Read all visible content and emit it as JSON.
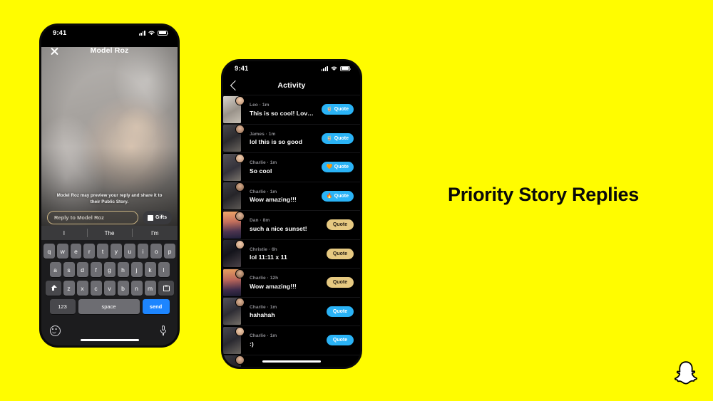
{
  "background_color": "#FFFC00",
  "headline": "Priority Story Replies",
  "brand": {
    "logo_name": "snapchat-ghost-logo"
  },
  "story_phone": {
    "status_bar": {
      "time": "9:41",
      "signal_icon": "cellular-signal-icon",
      "wifi_icon": "wifi-icon",
      "battery_icon": "battery-icon"
    },
    "close_icon": "close-icon",
    "title": "Model Roz",
    "disclaimer": "Model Roz may preview your reply and share it to their Public Story.",
    "reply_input": {
      "placeholder": "Reply to Model Roz",
      "value": ""
    },
    "gifts_button": {
      "label": "Gifts",
      "icon": "gift-icon"
    },
    "predictive": [
      "I",
      "The",
      "I'm"
    ],
    "keyboard": {
      "row1": [
        "q",
        "w",
        "e",
        "r",
        "t",
        "y",
        "u",
        "i",
        "o",
        "p"
      ],
      "row2": [
        "a",
        "s",
        "d",
        "f",
        "g",
        "h",
        "j",
        "k",
        "l"
      ],
      "row3": [
        "z",
        "x",
        "c",
        "v",
        "b",
        "n",
        "m"
      ],
      "shift_icon": "shift-icon",
      "delete_icon": "backspace-icon",
      "numeric_label": "123",
      "space_label": "space",
      "send_label": "send"
    },
    "emoji_icon": "emoji-icon",
    "mic_icon": "microphone-icon"
  },
  "activity_phone": {
    "status_bar": {
      "time": "9:41",
      "signal_icon": "cellular-signal-icon",
      "wifi_icon": "wifi-icon",
      "battery_icon": "battery-icon"
    },
    "back_icon": "back-chevron-icon",
    "title": "Activity",
    "quote_label": "Quote",
    "rows": [
      {
        "name": "Leo",
        "time": "1m",
        "message": "This is so cool! Love it!!!",
        "button_style": "blue",
        "emoji": "🧋",
        "thumb": "p-leo",
        "avatar": "a-skin1"
      },
      {
        "name": "James",
        "time": "1m",
        "message": "lol this is so good",
        "button_style": "blue",
        "emoji": "🧋",
        "thumb": "p-james",
        "avatar": "a-skin2"
      },
      {
        "name": "Charlie",
        "time": "1m",
        "message": "So cool",
        "button_style": "blue",
        "emoji": "🧡",
        "thumb": "p-charlie1",
        "avatar": "a-skin1"
      },
      {
        "name": "Charlie",
        "time": "1m",
        "message": "Wow amazing!!!",
        "button_style": "blue",
        "emoji": "🔥",
        "thumb": "p-charlie2",
        "avatar": "a-skin3"
      },
      {
        "name": "Dan",
        "time": "8m",
        "message": "such a nice sunset!",
        "button_style": "tan",
        "emoji": "",
        "thumb": "p-dan",
        "avatar": "a-skin2"
      },
      {
        "name": "Christie",
        "time": "6h",
        "message": "lol 11:11 x 11",
        "button_style": "tan",
        "emoji": "",
        "thumb": "p-christie",
        "avatar": "a-skin1"
      },
      {
        "name": "Charlie",
        "time": "12h",
        "message": "Wow amazing!!!",
        "button_style": "tan",
        "emoji": "",
        "thumb": "p-charlie3",
        "avatar": "a-skin3"
      },
      {
        "name": "Charlie",
        "time": "1m",
        "message": "hahahah",
        "button_style": "blue",
        "emoji": "",
        "thumb": "p-charlie4",
        "avatar": "a-skin2"
      },
      {
        "name": "Charlie",
        "time": "1m",
        "message": ":)",
        "button_style": "blue",
        "emoji": "",
        "thumb": "p-charlie5",
        "avatar": "a-skin1"
      },
      {
        "name": "",
        "time": "",
        "message": "",
        "button_style": "none",
        "emoji": "",
        "thumb": "p-charlie6",
        "avatar": "a-skin2"
      }
    ]
  }
}
